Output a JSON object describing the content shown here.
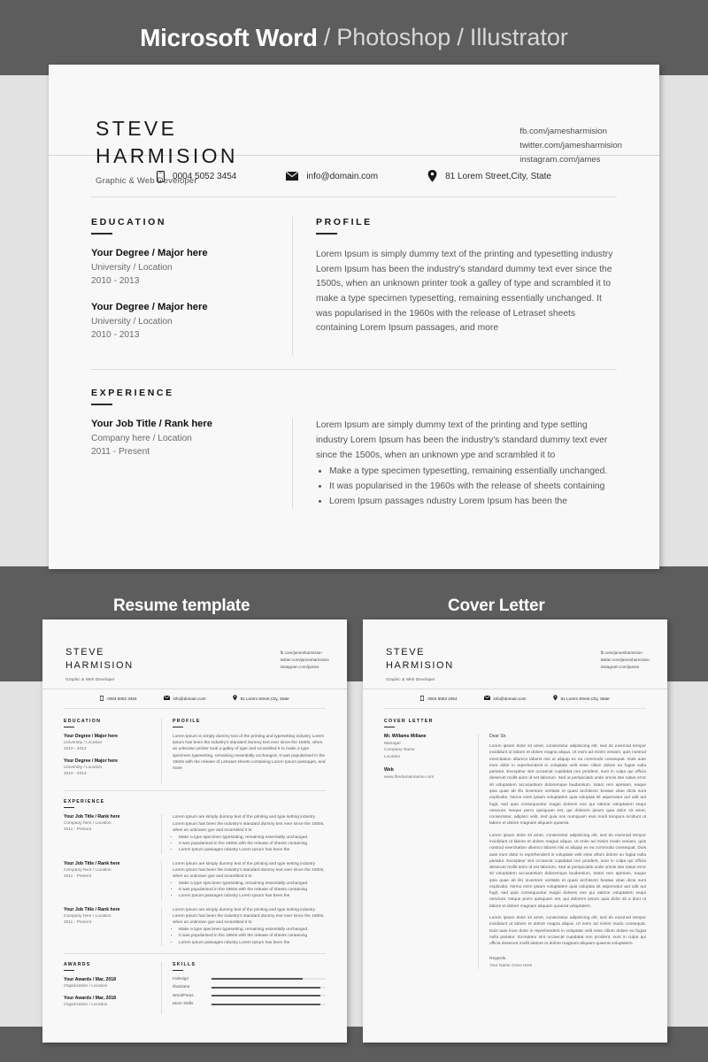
{
  "header": {
    "main": "Microsoft Word",
    "separator": "/",
    "sub1": "Photoshop",
    "sub2": "Illustrator"
  },
  "labels": {
    "resume": "Resume template",
    "cover": "Cover Letter"
  },
  "resume": {
    "first_name": "STEVE",
    "last_name": "HARMISION",
    "role": "Graphic & Web Developer",
    "social": [
      "fb.com/jamesharmision",
      "twitter.com/jamesharmision",
      "instagram.com/james"
    ],
    "contact": {
      "phone": "0004 5052 3454",
      "email": "info@domain.com",
      "address": "81 Lorem Street,City, State"
    },
    "education": {
      "title": "EDUCATION",
      "entries": [
        {
          "title": "Your Degree / Major here",
          "org": "University / Location",
          "date": "2010 - 2013"
        },
        {
          "title": "Your Degree / Major here",
          "org": "University / Location",
          "date": "2010 - 2013"
        }
      ]
    },
    "profile": {
      "title": "PROFILE",
      "text": "Lorem Ipsum is simply dummy text of the printing and typesetting industry Lorem Ipsum has been the industry's standard dummy text ever since the 1500s, when an unknown printer took a galley of type and scrambled it to make a type specimen typesetting, remaining essentially unchanged. It was popularised in the 1960s with the release of Letraset sheets containing Lorem Ipsum passages, and more"
    },
    "experience": {
      "title": "EXPERIENCE",
      "entries": [
        {
          "title": "Your Job Title / Rank here",
          "org": "Company here / Location",
          "date": "2011 - Present",
          "text": "Lorem Ipsum are simply dummy text of the printing and type setting industry Lorem Ipsum has been the industry's standard dummy text ever since the 1500s, when an unknown ype and scrambled it to",
          "bullets": [
            "Make a type specimen typesetting, remaining essentially unchanged.",
            "It was popularised in the 1960s with the release of sheets containing",
            "Lorem Ipsum passages ndustry Lorem Ipsum has been the"
          ]
        },
        {
          "title": "Your Job Title / Rank here",
          "org": "Company here / Location",
          "date": "2011 - Present",
          "text": "Lorem Ipsum are simply dummy text of the printing and type setting industry Lorem Ipsum has been the industry's standard dummy text ever since the 1500s, when an unknown ype and scrambled it to",
          "bullets": [
            "Make a type specimen typesetting, remaining essentially unchanged.",
            "It was popularised in the 1960s with the release of sheets containing",
            "Lorem Ipsum passages ndustry Lorem Ipsum has been the"
          ]
        },
        {
          "title": "Your Job Title / Rank here",
          "org": "Company here / Location",
          "date": "2011 - Present",
          "text": "Lorem Ipsum are simply dummy text of the printing and type setting industry Lorem Ipsum has been the industry's standard dummy text ever since the 1500s, when an unknown ype and scrambled it to",
          "bullets": [
            "Make a type specimen typesetting, remaining essentially unchanged.",
            "It was popularised in the 1960s with the release of sheets containing",
            "Lorem Ipsum passages ndustry Lorem Ipsum has been the"
          ]
        }
      ]
    },
    "awards": {
      "title": "AWARDS",
      "entries": [
        {
          "title": "Your Awards / Mar, 2018",
          "org": "Organization / Location"
        },
        {
          "title": "Your Awards / Mar, 2018",
          "org": "Organization / Location"
        }
      ]
    },
    "skills": {
      "title": "SKILLS",
      "items": [
        {
          "name": "Indesign",
          "level": 80
        },
        {
          "name": "Illustrator",
          "level": 95
        },
        {
          "name": "WordPress",
          "level": 95
        },
        {
          "name": "More Skills",
          "level": 95
        }
      ]
    }
  },
  "cover_letter": {
    "title": "COVER LETTER",
    "recipient_name": "Mr. Willams Millane",
    "recipient_role": "Manager",
    "recipient_company": "Company Name",
    "recipient_location": "Location",
    "web_label": "Web",
    "web_value": "www.thedomainname.com",
    "greeting": "Dear Sir,",
    "paragraphs": [
      "Lorem ipsum dolor sit amet, consectetur adipisicing elit, sed do eiusmod tempor incididunt ut labore et dolore magna aliqua. Ut enim ad minim veniam, quis nostrud exercitation ullamco laboris nisi ut aliquip ex ea commodo consequat. Duis aute irure dolor in reprehenderit in voluptate velit esse cillum dolore eu fugiat nulla pariatur. Excepteur sint occaecat cupidatat non proident, sunt in culpa qui officia deserunt mollit anim id est laborum. Sed ut perspiciatis unde omnis iste natus error sit voluptatem accusantium doloremque laudantium, totam rem aperiam, eaque ipsa quae ab illo inventore veritatis et quasi architecto beatae vitae dicta sunt explicabo. Nemo enim ipsam voluptatem quia voluptas sit aspernatur aut odit aut fugit, sed quia consequuntur magni dolores eos qui ratione voluptatem sequi nesciunt. Neque porro quisquam est, qui dolorem ipsum quia dolor sit amet, consectetur, adipisci velit, sed quia non numquam eius modi tempora incidunt ut labore et dolore magnam aliquam quaerat.",
      "Lorem ipsum dolor sit amet, consectetur adipisicing elit, sed do eiusmod tempor incididunt ut labore et dolore magna aliqua. Ut enim ad minim modo veniam, quis nostrud exercitation ullamco laboris nisi ut aliquip ex ea commodo consequat. Duis aute irure dolor in reprehenderit in voluptate velit esse cillum dolore eu fugiat nulla pariatur. Excepteur sint occaecat cupidatat non proident, sunt in culpa qui officia deserunt mollit anim id est laborum. Sed ut perspiciatis unde omnis iste natus error sit voluptatem accusantium doloremque laudantium, totam rem aperiam, eaque ipsa quae ab illo inventore veritatis et quasi architecto beatae vitae dicta sunt explicabo. Nemo enim ipsam voluptatem quia voluptas sit aspernatur aut odit aut fugit, sed quia consequuntur magni dolores eos qui ratione voluptatem sequi nesciunt. Neque porro quisquam est, qui dolorem ipsum quia dolor sit a dunt ut labore et dolore magnam aliquam quaerat voluptatem.",
      "Lorem ipsum dolor sit amet, consectetur adipisicing elit, sed do eiusmod tempor incididunt ut labore et dolore magna aliqua. Ut enim ad minim modo consequat. Duis aute irure dolor in reprehenderit in voluptate velit esse cillum dolore eu fugiat nulla pariatur. Excepteur sint occaecat cupidatat non proident, sunt in culpa qui officia deserunt mollit alatore et dolore magnam aliquam quaerat voluptatem."
    ],
    "closing": "Regards.",
    "signature": "Your Name Goes Here"
  }
}
